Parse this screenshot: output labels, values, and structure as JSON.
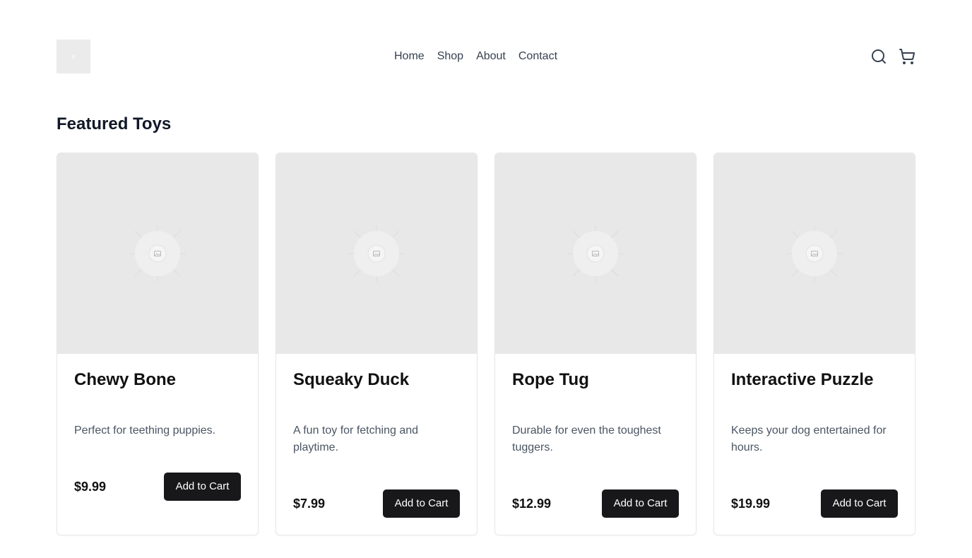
{
  "header": {
    "nav": [
      "Home",
      "Shop",
      "About",
      "Contact"
    ],
    "icons": [
      "search-icon",
      "cart-icon"
    ]
  },
  "section": {
    "title": "Featured Toys"
  },
  "products": [
    {
      "name": "Chewy Bone",
      "description": "Perfect for teething puppies.",
      "price": "$9.99",
      "button": "Add to Cart"
    },
    {
      "name": "Squeaky Duck",
      "description": "A fun toy for fetching and playtime.",
      "price": "$7.99",
      "button": "Add to Cart"
    },
    {
      "name": "Rope Tug",
      "description": "Durable for even the toughest tuggers.",
      "price": "$12.99",
      "button": "Add to Cart"
    },
    {
      "name": "Interactive Puzzle",
      "description": "Keeps your dog entertained for hours.",
      "price": "$19.99",
      "button": "Add to Cart"
    }
  ],
  "colors": {
    "button_bg": "#18181b",
    "placeholder_bg": "#e8e8e8",
    "text_primary": "#111111",
    "text_secondary": "#4b5563"
  }
}
